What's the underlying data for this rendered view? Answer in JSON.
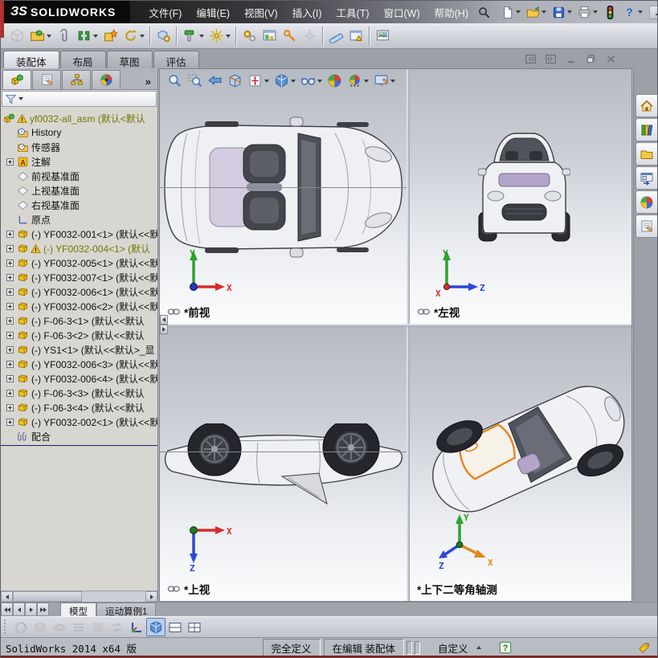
{
  "glyphs": {
    "question": "?",
    "annotation_a": "A",
    "expand_more": "»"
  },
  "titlebar": {
    "logo_mark": "ЗS",
    "logo_text": "SOLIDWORKS",
    "menu_items": [
      "文件(F)",
      "编辑(E)",
      "视图(V)",
      "插入(I)",
      "工具(T)",
      "窗口(W)",
      "帮助(H)"
    ],
    "quick_icons": [
      {
        "name": "new-document-icon",
        "caret": true
      },
      {
        "name": "open-document-icon",
        "caret": true
      },
      {
        "name": "save-document-icon",
        "caret": true
      },
      {
        "name": "print-document-icon",
        "caret": true
      },
      {
        "name": "selection-filter-icon",
        "caret": false
      },
      {
        "name": "help-icon",
        "caret": true
      }
    ]
  },
  "toolbar": {
    "icons": [
      {
        "name": "insert-component-icon",
        "disabled": true
      },
      {
        "name": "open-part-icon",
        "caret": true
      },
      {
        "name": "smart-fasteners-icon"
      },
      {
        "name": "mate-icon",
        "caret": true
      },
      {
        "name": "smart-component-icon"
      },
      {
        "name": "rotate-component-icon",
        "caret": true,
        "sep": true
      },
      {
        "name": "assembly-features-icon",
        "sep": true
      },
      {
        "name": "move-component-icon",
        "caret": true
      },
      {
        "name": "reference-geometry-icon",
        "caret": true,
        "sep": true
      },
      {
        "name": "motion-study-icon"
      },
      {
        "name": "assembly-visualization-icon"
      },
      {
        "name": "mate-controller-icon"
      },
      {
        "name": "exploded-view-icon",
        "disabled": true,
        "sep": true
      },
      {
        "name": "measure-icon"
      },
      {
        "name": "interference-detection-icon",
        "sep": true
      },
      {
        "name": "screen-capture-icon"
      }
    ]
  },
  "command_tabs": {
    "items": [
      "装配体",
      "布局",
      "草图",
      "评估"
    ],
    "active_index": 0
  },
  "mdi_buttons": [
    "split-left-icon",
    "split-right-icon",
    "minimize-window-icon",
    "restore-window-icon",
    "close-window-icon"
  ],
  "panel": {
    "tabs": [
      "featuremanager-icon",
      "propertymanager-icon",
      "configurationmanager-icon",
      "displaymanager-icon"
    ],
    "active_tab": 0,
    "tree": [
      {
        "icon": "assembly-icon",
        "warn": true,
        "olive": true,
        "indent": 0,
        "label": "yf0032-all_asm (默认<默认"
      },
      {
        "icon": "history-icon",
        "indent": 1,
        "label": "History"
      },
      {
        "icon": "sensors-icon",
        "indent": 1,
        "label": "传感器"
      },
      {
        "icon": "annotations-icon",
        "indent": 1,
        "expand": true,
        "label": "注解"
      },
      {
        "icon": "plane-icon",
        "indent": 1,
        "label": "前视基准面"
      },
      {
        "icon": "plane-icon",
        "indent": 1,
        "label": "上视基准面"
      },
      {
        "icon": "plane-icon",
        "indent": 1,
        "label": "右视基准面"
      },
      {
        "icon": "origin-icon",
        "indent": 1,
        "label": "原点"
      },
      {
        "icon": "part-icon",
        "indent": 1,
        "expand": true,
        "label": "(-) YF0032-001<1> (默认<<默"
      },
      {
        "icon": "part-icon",
        "indent": 1,
        "expand": true,
        "warn": true,
        "olive": true,
        "label": "(-) YF0032-004<1> (默认"
      },
      {
        "icon": "part-icon",
        "indent": 1,
        "expand": true,
        "label": "(-) YF0032-005<1> (默认<<默"
      },
      {
        "icon": "part-icon",
        "indent": 1,
        "expand": true,
        "label": "(-) YF0032-007<1> (默认<<默"
      },
      {
        "icon": "part-icon",
        "indent": 1,
        "expand": true,
        "label": "(-) YF0032-006<1> (默认<<默"
      },
      {
        "icon": "part-icon",
        "indent": 1,
        "expand": true,
        "label": "(-) YF0032-006<2> (默认<<默"
      },
      {
        "icon": "part-icon",
        "indent": 1,
        "expand": true,
        "label": "(-) F-06-3<1> (默认<<默认"
      },
      {
        "icon": "part-icon",
        "indent": 1,
        "expand": true,
        "label": "(-) F-06-3<2> (默认<<默认"
      },
      {
        "icon": "part-icon",
        "indent": 1,
        "expand": true,
        "label": "(-) YS1<1> (默认<<默认>_显"
      },
      {
        "icon": "part-icon",
        "indent": 1,
        "expand": true,
        "label": "(-) YF0032-006<3> (默认<<默"
      },
      {
        "icon": "part-icon",
        "indent": 1,
        "expand": true,
        "label": "(-) YF0032-006<4> (默认<<默"
      },
      {
        "icon": "part-icon",
        "indent": 1,
        "expand": true,
        "label": "(-) F-06-3<3> (默认<<默认"
      },
      {
        "icon": "part-icon",
        "indent": 1,
        "expand": true,
        "label": "(-) F-06-3<4> (默认<<默认"
      },
      {
        "icon": "part-icon",
        "indent": 1,
        "expand": true,
        "label": "(-) YF0032-002<1> (默认<<默"
      },
      {
        "icon": "mates-icon",
        "indent": 1,
        "label": "配合"
      }
    ]
  },
  "headsup": {
    "icons": [
      {
        "name": "zoom-fit-icon"
      },
      {
        "name": "zoom-area-icon"
      },
      {
        "name": "previous-view-icon"
      },
      {
        "name": "section-view-icon"
      },
      {
        "name": "view-orientation-icon",
        "caret": true
      },
      {
        "name": "display-style-icon",
        "caret": true
      },
      {
        "name": "hide-show-items-icon",
        "caret": true
      },
      {
        "name": "appearance-icon"
      },
      {
        "name": "scene-icon",
        "caret": true
      },
      {
        "name": "view-setting-icon",
        "caret": true
      }
    ]
  },
  "viewports": [
    {
      "label": "*前视",
      "linked": true,
      "triad": {
        "letters": [
          "Y",
          "X"
        ],
        "colors": [
          "#1f9e1f",
          "#d92b2b"
        ]
      }
    },
    {
      "label": "*左视",
      "linked": true,
      "triad": {
        "letters": [
          "Y",
          "Z",
          "X"
        ],
        "colors": [
          "#1f9e1f",
          "#2b48d9",
          "#d92b2b"
        ]
      }
    },
    {
      "label": "*上视",
      "linked": true,
      "triad": {
        "letters": [
          "X",
          "Z"
        ],
        "colors": [
          "#d92b2b",
          "#2b48d9"
        ]
      }
    },
    {
      "label": "*上下二等角轴测",
      "linked": false,
      "triad": {
        "letters": [
          "Y",
          "X",
          "Z"
        ],
        "colors": [
          "#1f9e1f",
          "#e08a1e",
          "#2b48d9"
        ]
      }
    }
  ],
  "taskpane": {
    "icons": [
      "home-icon",
      "design-library-icon",
      "file-explorer-icon",
      "view-palette-icon",
      "appearances-icon",
      "custom-properties-icon"
    ]
  },
  "bottom": {
    "doc_tabs": [
      "模型",
      "运动算例1"
    ],
    "active_tab": 0,
    "view_icons": [
      {
        "name": "pan-view-icon",
        "disabled": true
      },
      {
        "name": "layers-icon",
        "disabled": true
      },
      {
        "name": "orbit-icon",
        "disabled": true
      },
      {
        "name": "line-style-icon",
        "disabled": true
      },
      {
        "name": "hatch-icon",
        "disabled": true
      },
      {
        "name": "sync-views-icon",
        "disabled": true
      },
      {
        "name": "axes-icon"
      },
      {
        "name": "single-view-icon",
        "active": true
      },
      {
        "name": "two-view-icon"
      },
      {
        "name": "four-view-icon"
      }
    ]
  },
  "statusbar": {
    "left_text": "SolidWorks 2014 x64 版",
    "define_state": "完全定义",
    "edit_state": "在编辑 装配体",
    "unit_label": "自定义"
  },
  "colors": {
    "accent_orange": "#e8831f",
    "rollback_blue": "#2f55c8",
    "warn_yellow": "#f2c218",
    "olive_text": "#757500"
  }
}
